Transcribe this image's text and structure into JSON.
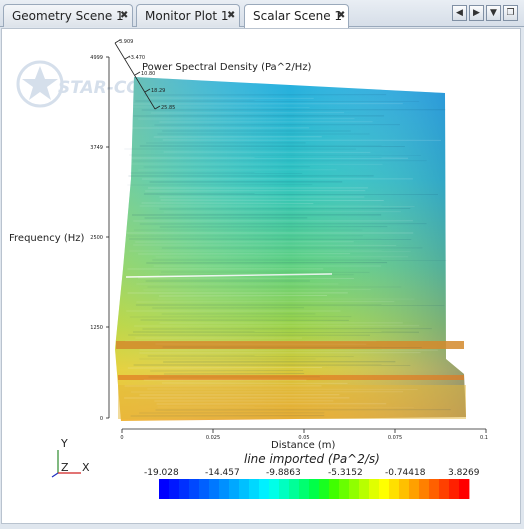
{
  "tabs": [
    {
      "label": "Geometry Scene 1",
      "close": "✖"
    },
    {
      "label": "Monitor Plot 1",
      "close": "✖"
    },
    {
      "label": "Scalar Scene 1",
      "close": "✖"
    }
  ],
  "nav": {
    "prev": "◀",
    "next": "▶",
    "menu": "▼",
    "restore": "❐"
  },
  "watermark": {
    "text": "STAR-CCM+"
  },
  "plot": {
    "top_label": "Power Spectral Density  (Pa^2/Hz)",
    "top_ticks": [
      "3.909",
      "-3.470",
      "10.80",
      "18.29",
      "25.85"
    ],
    "y_label": "Frequency  (Hz)",
    "y_ticks": [
      "4999",
      "3749",
      "2500",
      "1250",
      "0"
    ],
    "x_label": "Distance  (m)",
    "x_ticks": [
      "0",
      "0.025",
      "0.05",
      "0.075",
      "0.1"
    ]
  },
  "colorbar": {
    "title": "line imported (Pa^2/s)",
    "ticks": [
      "-19.028",
      "-14.457",
      "-9.8863",
      "-5.3152",
      "-0.74418",
      "3.8269"
    ],
    "colors": [
      "#0000ff",
      "#0018ff",
      "#0030ff",
      "#0048ff",
      "#0060ff",
      "#0078ff",
      "#0090ff",
      "#00a8ff",
      "#00c0ff",
      "#00d8ff",
      "#00f0ff",
      "#00ffe8",
      "#00ffc0",
      "#00ff98",
      "#00ff70",
      "#00ff48",
      "#18ff20",
      "#40ff00",
      "#68ff00",
      "#90ff00",
      "#b8ff00",
      "#e0ff00",
      "#ffff00",
      "#ffe000",
      "#ffc000",
      "#ffa000",
      "#ff8000",
      "#ff6000",
      "#ff4000",
      "#ff2000",
      "#ff0000"
    ]
  },
  "triad": {
    "y": "Y",
    "z": "Z",
    "x": "X"
  }
}
